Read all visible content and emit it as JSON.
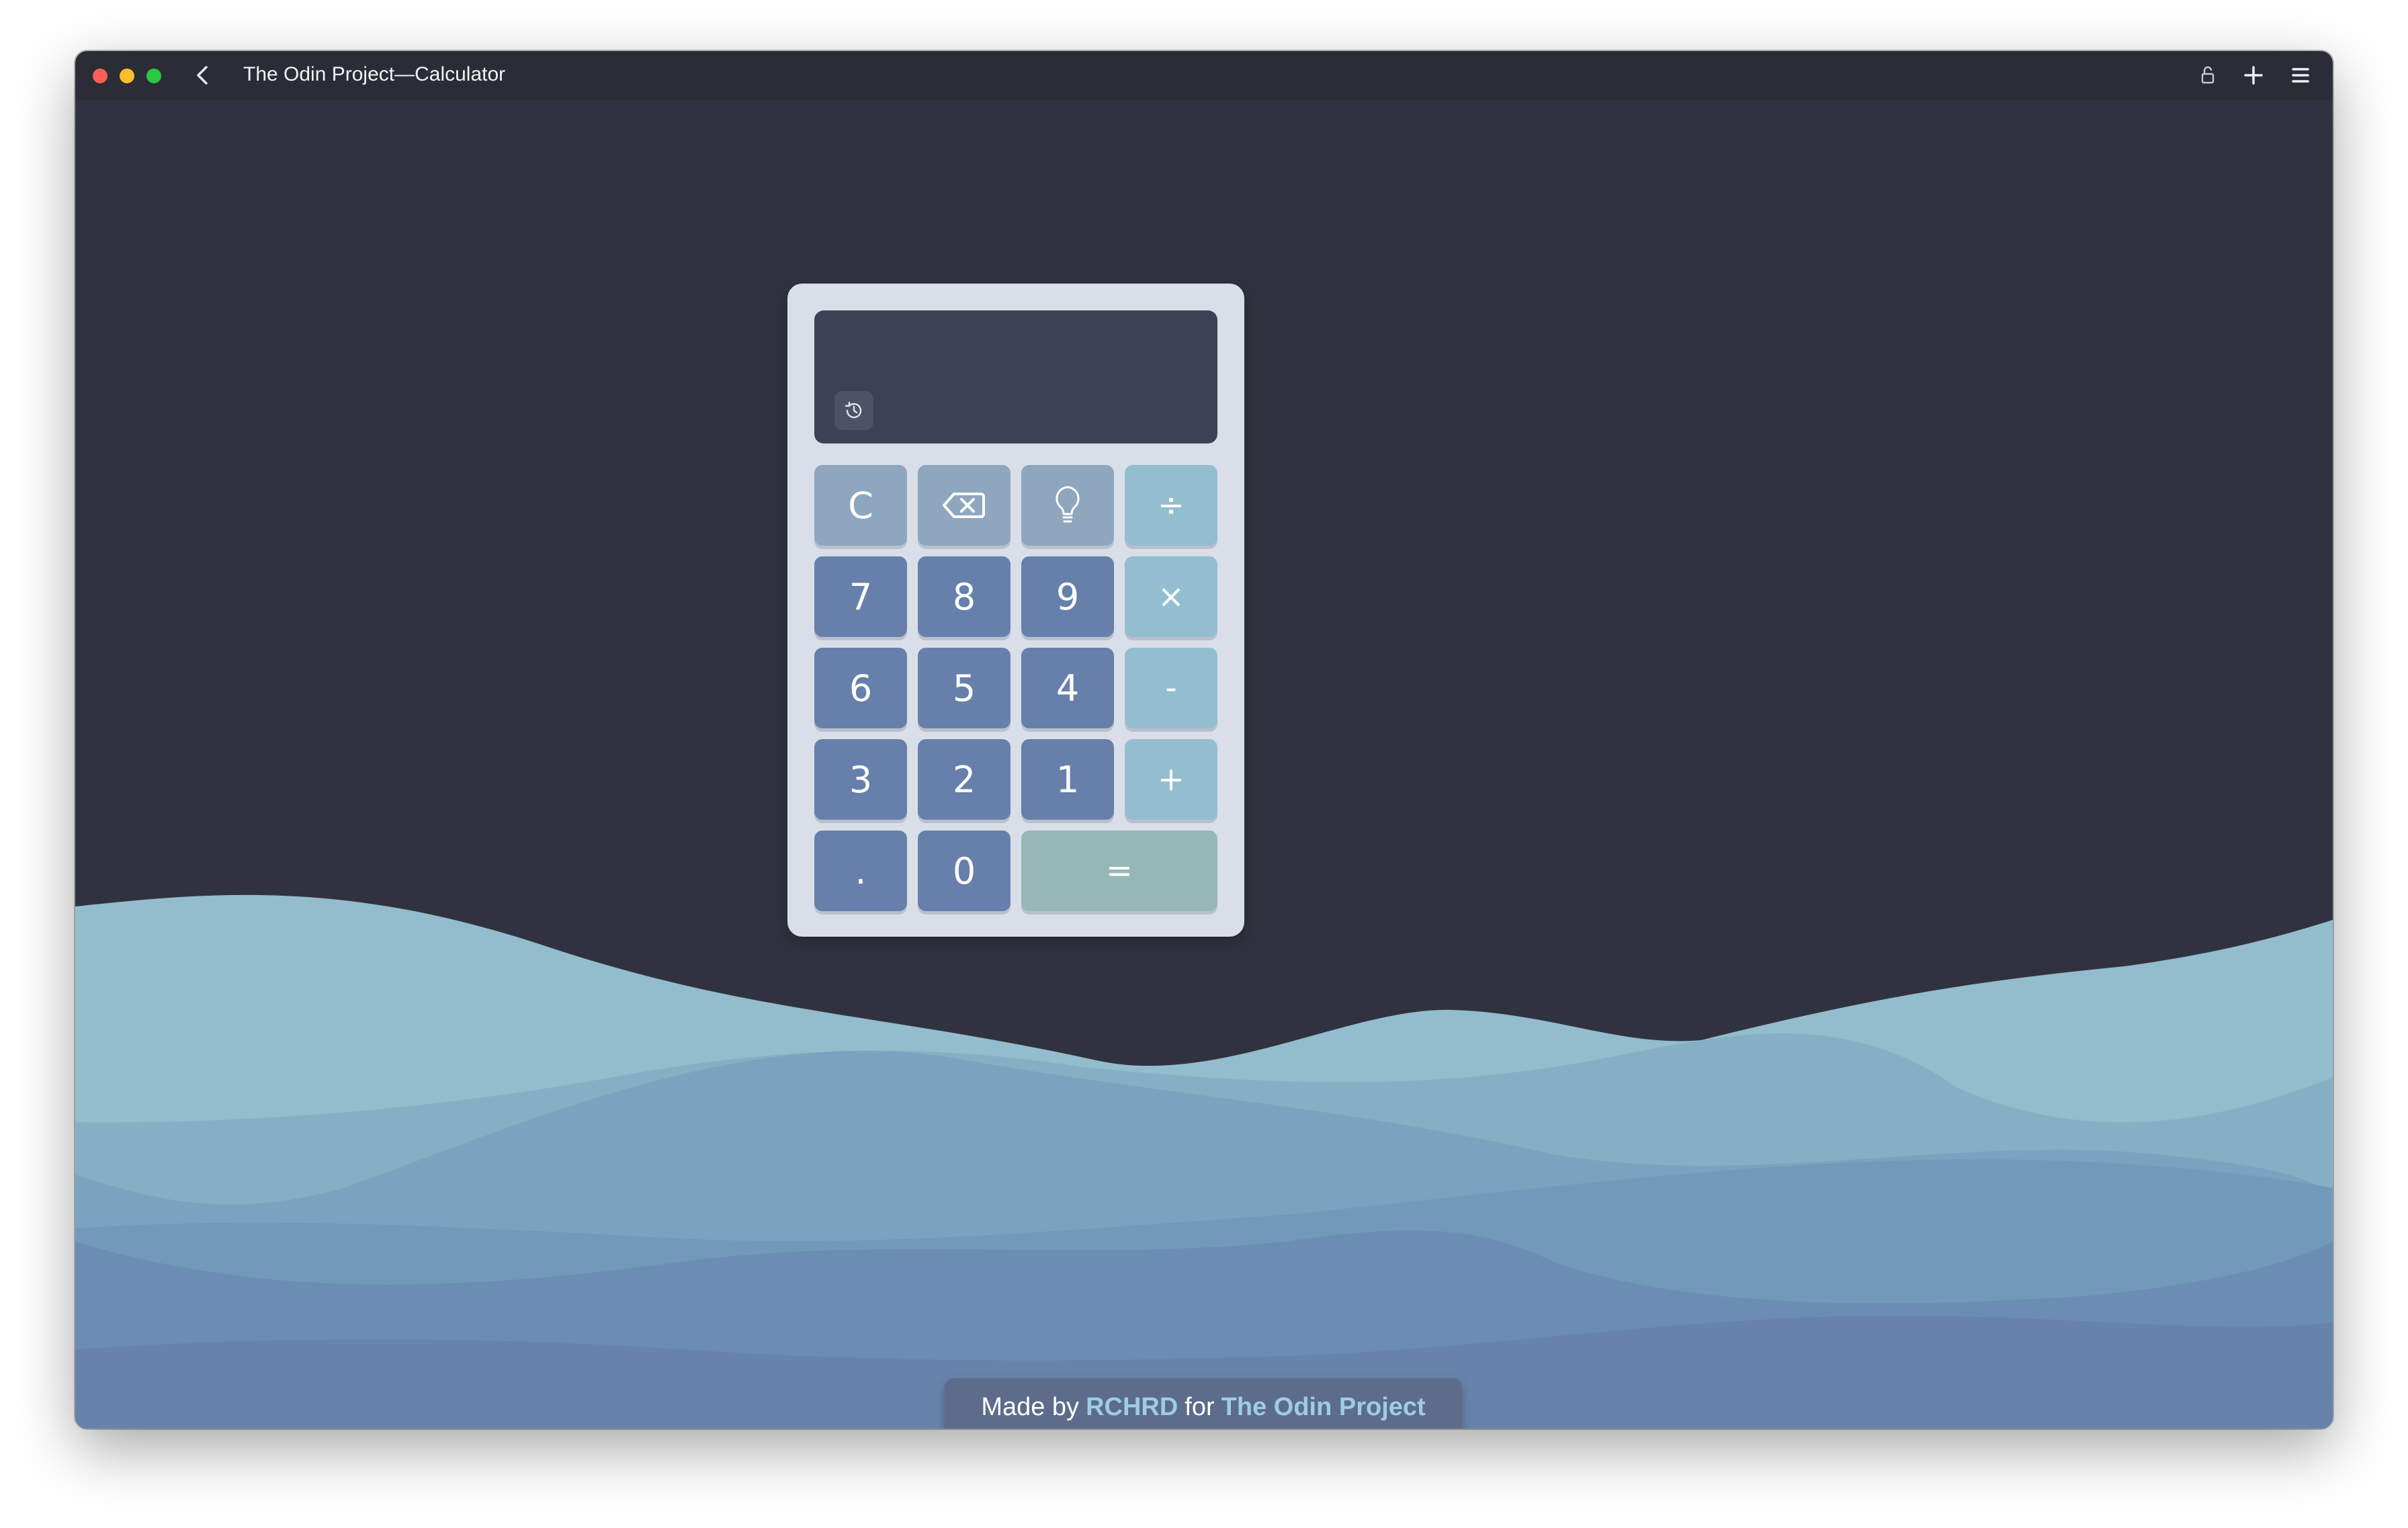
{
  "window": {
    "title": "The Odin Project—Calculator",
    "controls": [
      "close",
      "minimize",
      "zoom"
    ],
    "toolbar_icons": [
      "back-icon",
      "lock-icon",
      "plus-icon",
      "menu-icon"
    ]
  },
  "calculator": {
    "display_value": "",
    "history_icon": "history-icon",
    "keys": {
      "clear": "C",
      "backspace_icon": "backspace-icon",
      "hint_icon": "lightbulb-icon",
      "divide": "÷",
      "seven": "7",
      "eight": "8",
      "nine": "9",
      "multiply": "×",
      "six": "6",
      "five": "5",
      "four": "4",
      "subtract": "-",
      "three": "3",
      "two": "2",
      "one": "1",
      "add": "+",
      "decimal": ".",
      "zero": "0",
      "equals": "="
    }
  },
  "footer": {
    "prefix": "Made by",
    "author": "RCHRD",
    "middle": "for",
    "project": "The Odin Project"
  },
  "colors": {
    "background": "#30333f",
    "calculator_body": "#d9dee8",
    "display": "#3c4253",
    "function_key": "#8fa6bf",
    "number_key": "#6680ab",
    "operator_key": "#93bed0",
    "equals_key": "#96b7b7",
    "footer_link": "#9ccde4"
  }
}
